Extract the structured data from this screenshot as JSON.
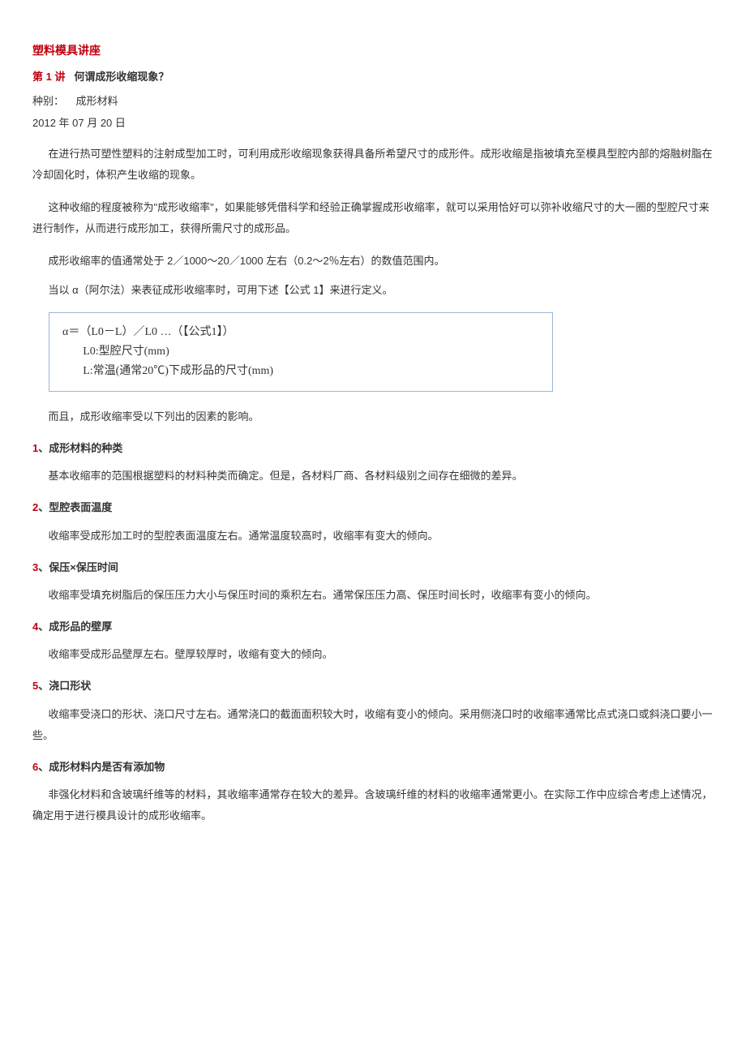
{
  "title": "塑料模具讲座",
  "lecture": {
    "num": "第 1 讲",
    "name": "何谓成形收缩现象？"
  },
  "category_label": "种别：",
  "category_value": "成形材料",
  "date": "2012 年 07 月 20 日",
  "p1": "在进行热可塑性塑料的注射成型加工时，可利用成形收缩现象获得具备所希望尺寸的成形件。成形收缩是指被填充至模具型腔内部的熔融树脂在冷却固化时，体积产生收缩的现象。",
  "p2": "这种收缩的程度被称为\"成形收缩率\"，如果能够凭借科学和经验正确掌握成形收缩率，就可以采用恰好可以弥补收缩尺寸的大一圈的型腔尺寸来进行制作，从而进行成形加工，获得所需尺寸的成形品。",
  "p3": "成形收缩率的值通常处于 2／1000～20／1000 左右（0.2～2％左右）的数值范围内。",
  "p4": "当以 α（阿尔法）来表征成形收缩率时，可用下述【公式 1】来进行定义。",
  "formula": {
    "line1": "α＝（L0－L）／L0 …（【公式1】）",
    "line2": "L0:型腔尺寸(mm)",
    "line3": "L:常温(通常20℃)下成形品的尺寸(mm)"
  },
  "p5": "而且，成形收缩率受以下列出的因素的影响。",
  "sections": [
    {
      "num": "1",
      "heading": "、成形材料的种类",
      "body": "基本收缩率的范围根据塑料的材料种类而确定。但是，各材料厂商、各材料级别之间存在细微的差异。"
    },
    {
      "num": "2",
      "heading": "、型腔表面温度",
      "body": "收缩率受成形加工时的型腔表面温度左右。通常温度较高时，收缩率有变大的倾向。"
    },
    {
      "num": "3",
      "heading": "、保压×保压时间",
      "body": "收缩率受填充树脂后的保压压力大小与保压时间的乘积左右。通常保压压力高、保压时间长时，收缩率有变小的倾向。"
    },
    {
      "num": "4",
      "heading": "、成形品的壁厚",
      "body": "收缩率受成形品壁厚左右。壁厚较厚时，收缩有变大的倾向。"
    },
    {
      "num": "5",
      "heading": "、浇口形状",
      "body": "收缩率受浇口的形状、浇口尺寸左右。通常浇口的截面面积较大时，收缩有变小的倾向。采用侧浇口时的收缩率通常比点式浇口或斜浇口要小一些。"
    },
    {
      "num": "6",
      "heading": "、成形材料内是否有添加物",
      "body": "非强化材料和含玻璃纤维等的材料，其收缩率通常存在较大的差异。含玻璃纤维的材料的收缩率通常更小。在实际工作中应综合考虑上述情况，确定用于进行模具设计的成形收缩率。"
    }
  ]
}
